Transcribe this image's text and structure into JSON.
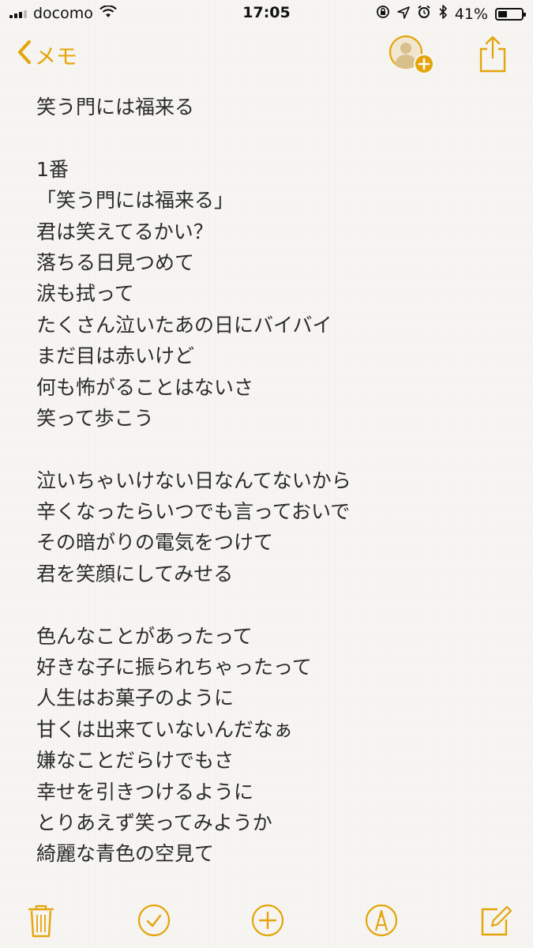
{
  "status_bar": {
    "carrier": "docomo",
    "time": "17:05",
    "battery_percent": "41%",
    "battery_level": 0.41,
    "icons": [
      "signal-icon",
      "wifi-icon",
      "orientation-lock-icon",
      "location-arrow-icon",
      "alarm-icon",
      "bluetooth-icon",
      "battery-icon"
    ]
  },
  "nav": {
    "back_label": "メモ"
  },
  "note": {
    "lines": [
      "笑う門には福来る",
      "",
      "1番",
      "「笑う門には福来る」",
      "君は笑えてるかい？",
      "落ちる日見つめて",
      "涙も拭って",
      "たくさん泣いたあの日にバイバイ",
      "まだ目は赤いけど",
      "何も怖がることはないさ",
      "笑って歩こう",
      "",
      "泣いちゃいけない日なんてないから",
      "辛くなったらいつでも言っておいで",
      "その暗がりの電気をつけて",
      "君を笑顔にしてみせる",
      "",
      "色んなことがあったって",
      "好きな子に振られちゃったって",
      "人生はお菓子のように",
      "甘くは出来ていないんだなぁ",
      "嫌なことだらけでもさ",
      "幸せを引きつけるように",
      "とりあえず笑ってみようか",
      "綺麗な青色の空見て"
    ]
  },
  "colors": {
    "accent": "#e5a40a",
    "background": "#f7f6f2",
    "text": "#2b2b2b"
  },
  "toolbar": {
    "icons": [
      "trash-icon",
      "checklist-icon",
      "add-icon",
      "markup-icon",
      "compose-icon"
    ]
  }
}
